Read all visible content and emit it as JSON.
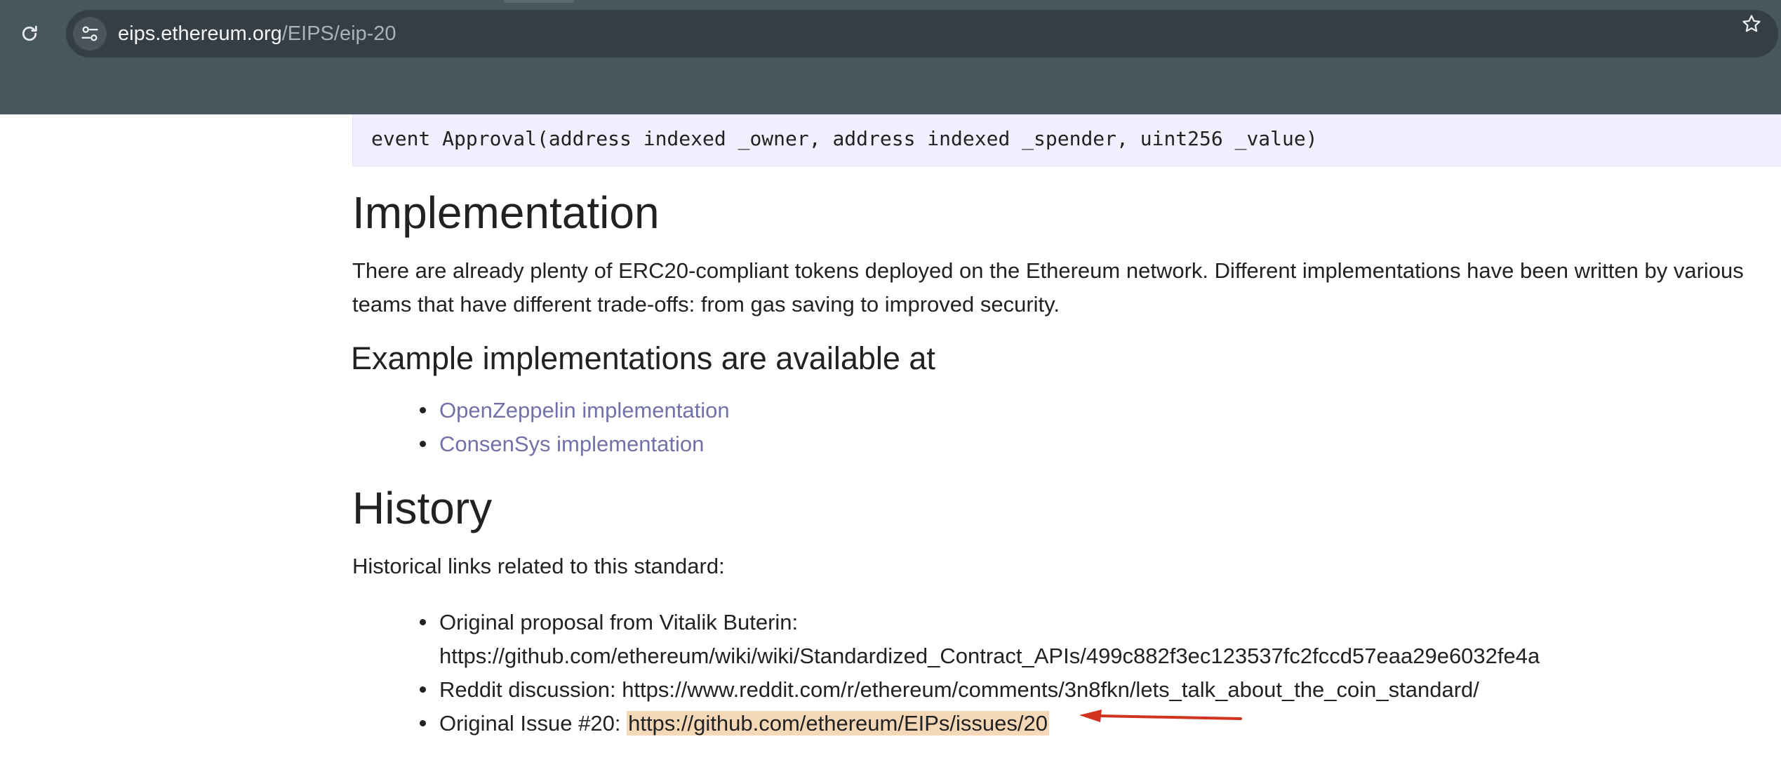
{
  "browser": {
    "url_host": "eips.ethereum.org",
    "url_path": "/EIPS/eip-20",
    "icons": {
      "reload": "reload-icon",
      "site_info": "tune-icon",
      "bookmark": "star-icon"
    }
  },
  "code": {
    "line": "event Approval(address indexed _owner, address indexed _spender, uint256 _value)"
  },
  "implementation": {
    "heading": "Implementation",
    "paragraph": "There are already plenty of ERC20-compliant tokens deployed on the Ethereum network. Different implementations have been written by various teams that have different trade-offs: from gas saving to improved security.",
    "subheading": "Example implementations are available at",
    "links": [
      {
        "label": "OpenZeppelin implementation"
      },
      {
        "label": "ConsenSys implementation"
      }
    ]
  },
  "history": {
    "heading": "History",
    "intro": "Historical links related to this standard:",
    "items": [
      {
        "prefix": "Original proposal from Vitalik Buterin:",
        "url": "https://github.com/ethereum/wiki/wiki/Standardized_Contract_APIs/499c882f3ec123537fc2fccd57eaa29e6032fe4a"
      },
      {
        "prefix": "Reddit discussion: ",
        "url": "https://www.reddit.com/r/ethereum/comments/3n8fkn/lets_talk_about_the_coin_standard/"
      },
      {
        "prefix": "Original Issue #20: ",
        "url": "https://github.com/ethereum/EIPs/issues/20"
      }
    ]
  },
  "annotation": {
    "arrow_color": "#d0321e",
    "highlight_color": "#f5d8b8"
  }
}
